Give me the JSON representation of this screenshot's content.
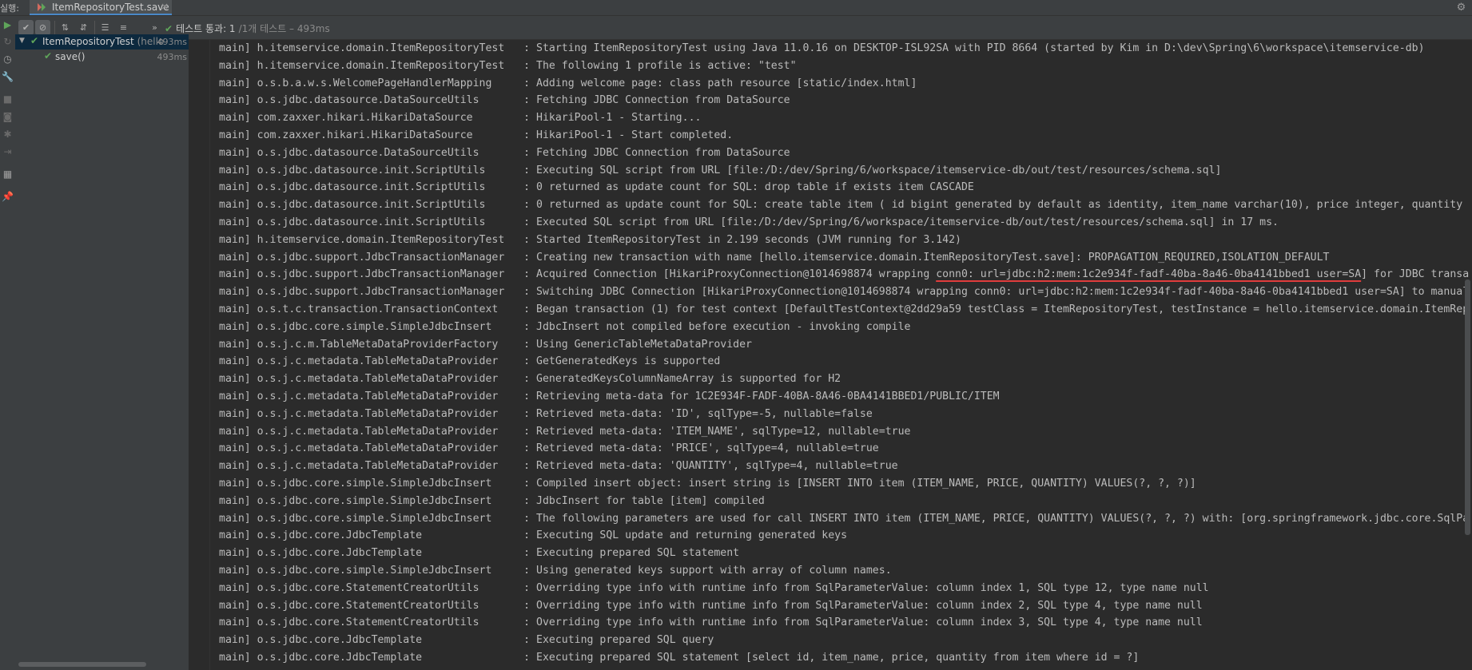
{
  "top_bar": {
    "run_label": "실행:",
    "run_tab_title": "ItemRepositoryTest.save",
    "close_glyph": "×",
    "settings_icon": "gear-icon"
  },
  "toolbar": {
    "status_label": "테스트 통과: 1",
    "status_detail": "/1개 테스트 – 493ms",
    "buttons": [
      "show-passed",
      "show-ignored",
      "sort-alphabetically",
      "sort-by-duration",
      "expand-all",
      "collapse-all",
      "next-failed"
    ]
  },
  "tree": {
    "root": {
      "name": "ItemRepositoryTest",
      "package_hint": "(hello",
      "time": "493ms"
    },
    "children": [
      {
        "name": "save()",
        "time": "493ms"
      }
    ]
  },
  "log": {
    "thread": "main]",
    "lines": [
      {
        "logger": "h.itemservice.domain.ItemRepositoryTest  ",
        "msg": "Starting ItemRepositoryTest using Java 11.0.16 on DESKTOP-ISL92SA with PID 8664 (started by Kim in D:\\dev\\Spring\\6\\workspace\\itemservice-db)"
      },
      {
        "logger": "h.itemservice.domain.ItemRepositoryTest  ",
        "msg": "The following 1 profile is active: \"test\""
      },
      {
        "logger": "o.s.b.a.w.s.WelcomePageHandlerMapping    ",
        "msg": "Adding welcome page: class path resource [static/index.html]"
      },
      {
        "logger": "o.s.jdbc.datasource.DataSourceUtils      ",
        "msg": "Fetching JDBC Connection from DataSource"
      },
      {
        "logger": "com.zaxxer.hikari.HikariDataSource       ",
        "msg": "HikariPool-1 - Starting..."
      },
      {
        "logger": "com.zaxxer.hikari.HikariDataSource       ",
        "msg": "HikariPool-1 - Start completed."
      },
      {
        "logger": "o.s.jdbc.datasource.DataSourceUtils      ",
        "msg": "Fetching JDBC Connection from DataSource"
      },
      {
        "logger": "o.s.jdbc.datasource.init.ScriptUtils     ",
        "msg": "Executing SQL script from URL [file:/D:/dev/Spring/6/workspace/itemservice-db/out/test/resources/schema.sql]"
      },
      {
        "logger": "o.s.jdbc.datasource.init.ScriptUtils     ",
        "msg": "0 returned as update count for SQL: drop table if exists item CASCADE"
      },
      {
        "logger": "o.s.jdbc.datasource.init.ScriptUtils     ",
        "msg": "0 returned as update count for SQL: create table item ( id bigint generated by default as identity, item_name varchar(10), price integer, quantity"
      },
      {
        "logger": "o.s.jdbc.datasource.init.ScriptUtils     ",
        "msg": "Executed SQL script from URL [file:/D:/dev/Spring/6/workspace/itemservice-db/out/test/resources/schema.sql] in 17 ms."
      },
      {
        "logger": "h.itemservice.domain.ItemRepositoryTest  ",
        "msg": "Started ItemRepositoryTest in 2.199 seconds (JVM running for 3.142)"
      },
      {
        "logger": "o.s.jdbc.support.JdbcTransactionManager  ",
        "msg": "Creating new transaction with name [hello.itemservice.domain.ItemRepositoryTest.save]: PROPAGATION_REQUIRED,ISOLATION_DEFAULT"
      },
      {
        "logger": "o.s.jdbc.support.JdbcTransactionManager  ",
        "msg": "Acquired Connection [HikariProxyConnection@1014698874 wrapping ",
        "highlight": "conn0: url=jdbc:h2:mem:1c2e934f-fadf-40ba-8a46-0ba4141bbed1 user=SA",
        "msg_after": "] for JDBC transa"
      },
      {
        "logger": "o.s.jdbc.support.JdbcTransactionManager  ",
        "msg": "Switching JDBC Connection [HikariProxyConnection@1014698874 wrapping conn0: url=jdbc:h2:mem:1c2e934f-fadf-40ba-8a46-0ba4141bbed1 user=SA] to manual"
      },
      {
        "logger": "o.s.t.c.transaction.TransactionContext   ",
        "msg": "Began transaction (1) for test context [DefaultTestContext@2dd29a59 testClass = ItemRepositoryTest, testInstance = hello.itemservice.domain.ItemRep"
      },
      {
        "logger": "o.s.jdbc.core.simple.SimpleJdbcInsert    ",
        "msg": "JdbcInsert not compiled before execution - invoking compile"
      },
      {
        "logger": "o.s.j.c.m.TableMetaDataProviderFactory   ",
        "msg": "Using GenericTableMetaDataProvider"
      },
      {
        "logger": "o.s.j.c.metadata.TableMetaDataProvider   ",
        "msg": "GetGeneratedKeys is supported"
      },
      {
        "logger": "o.s.j.c.metadata.TableMetaDataProvider   ",
        "msg": "GeneratedKeysColumnNameArray is supported for H2"
      },
      {
        "logger": "o.s.j.c.metadata.TableMetaDataProvider   ",
        "msg": "Retrieving meta-data for 1C2E934F-FADF-40BA-8A46-0BA4141BBED1/PUBLIC/ITEM"
      },
      {
        "logger": "o.s.j.c.metadata.TableMetaDataProvider   ",
        "msg": "Retrieved meta-data: 'ID', sqlType=-5, nullable=false"
      },
      {
        "logger": "o.s.j.c.metadata.TableMetaDataProvider   ",
        "msg": "Retrieved meta-data: 'ITEM_NAME', sqlType=12, nullable=true"
      },
      {
        "logger": "o.s.j.c.metadata.TableMetaDataProvider   ",
        "msg": "Retrieved meta-data: 'PRICE', sqlType=4, nullable=true"
      },
      {
        "logger": "o.s.j.c.metadata.TableMetaDataProvider   ",
        "msg": "Retrieved meta-data: 'QUANTITY', sqlType=4, nullable=true"
      },
      {
        "logger": "o.s.jdbc.core.simple.SimpleJdbcInsert    ",
        "msg": "Compiled insert object: insert string is [INSERT INTO item (ITEM_NAME, PRICE, QUANTITY) VALUES(?, ?, ?)]"
      },
      {
        "logger": "o.s.jdbc.core.simple.SimpleJdbcInsert    ",
        "msg": "JdbcInsert for table [item] compiled"
      },
      {
        "logger": "o.s.jdbc.core.simple.SimpleJdbcInsert    ",
        "msg": "The following parameters are used for call INSERT INTO item (ITEM_NAME, PRICE, QUANTITY) VALUES(?, ?, ?) with: [org.springframework.jdbc.core.SqlPa"
      },
      {
        "logger": "o.s.jdbc.core.JdbcTemplate               ",
        "msg": "Executing SQL update and returning generated keys"
      },
      {
        "logger": "o.s.jdbc.core.JdbcTemplate               ",
        "msg": "Executing prepared SQL statement"
      },
      {
        "logger": "o.s.jdbc.core.simple.SimpleJdbcInsert    ",
        "msg": "Using generated keys support with array of column names."
      },
      {
        "logger": "o.s.jdbc.core.StatementCreatorUtils      ",
        "msg": "Overriding type info with runtime info from SqlParameterValue: column index 1, SQL type 12, type name null"
      },
      {
        "logger": "o.s.jdbc.core.StatementCreatorUtils      ",
        "msg": "Overriding type info with runtime info from SqlParameterValue: column index 2, SQL type 4, type name null"
      },
      {
        "logger": "o.s.jdbc.core.StatementCreatorUtils      ",
        "msg": "Overriding type info with runtime info from SqlParameterValue: column index 3, SQL type 4, type name null"
      },
      {
        "logger": "o.s.jdbc.core.JdbcTemplate               ",
        "msg": "Executing prepared SQL query"
      },
      {
        "logger": "o.s.jdbc.core.JdbcTemplate               ",
        "msg": "Executing prepared SQL statement [select id, item_name, price, quantity from item where id = ?]"
      }
    ]
  }
}
